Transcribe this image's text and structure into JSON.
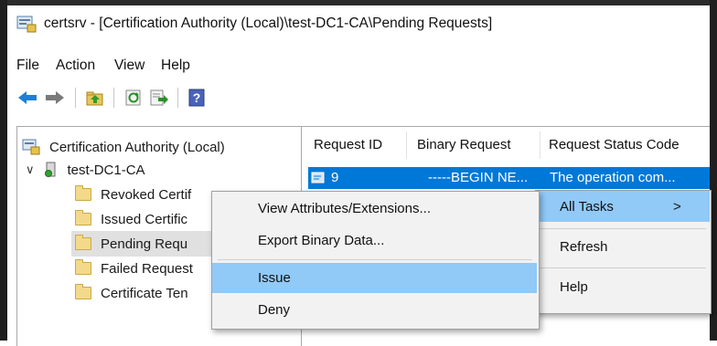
{
  "window": {
    "title": "certsrv - [Certification Authority (Local)\\test-DC1-CA\\Pending Requests]"
  },
  "menubar": [
    "File",
    "Action",
    "View",
    "Help"
  ],
  "toolbar": {
    "buttons": [
      "back-arrow-icon",
      "forward-arrow-icon",
      "up-folder-icon",
      "refresh-icon",
      "export-list-icon",
      "help-icon"
    ],
    "help_glyph": "?"
  },
  "tree": {
    "root": "Certification Authority (Local)",
    "ca_node": "test-DC1-CA",
    "ca_expander": "∨",
    "children": [
      "Revoked Certif",
      "Issued Certific",
      "Pending Requ",
      "Failed Request",
      "Certificate Ten"
    ]
  },
  "list": {
    "columns": [
      "Request ID",
      "Binary Request",
      "Request Status Code"
    ],
    "rows": [
      {
        "request_id": "9",
        "binary_request": "-----BEGIN NE...",
        "status": "The operation com..."
      }
    ]
  },
  "context_menu": {
    "items": [
      "View Attributes/Extensions...",
      "Export Binary Data...",
      "Issue",
      "Deny"
    ],
    "highlighted": "Issue"
  },
  "main_menu": {
    "items": [
      "All Tasks",
      "Refresh",
      "Help"
    ],
    "submenu_arrow": ">"
  },
  "colors": {
    "selection": "#0078d7",
    "menu_highlight": "#91c9f7",
    "menu_background": "#f2f2f2"
  }
}
